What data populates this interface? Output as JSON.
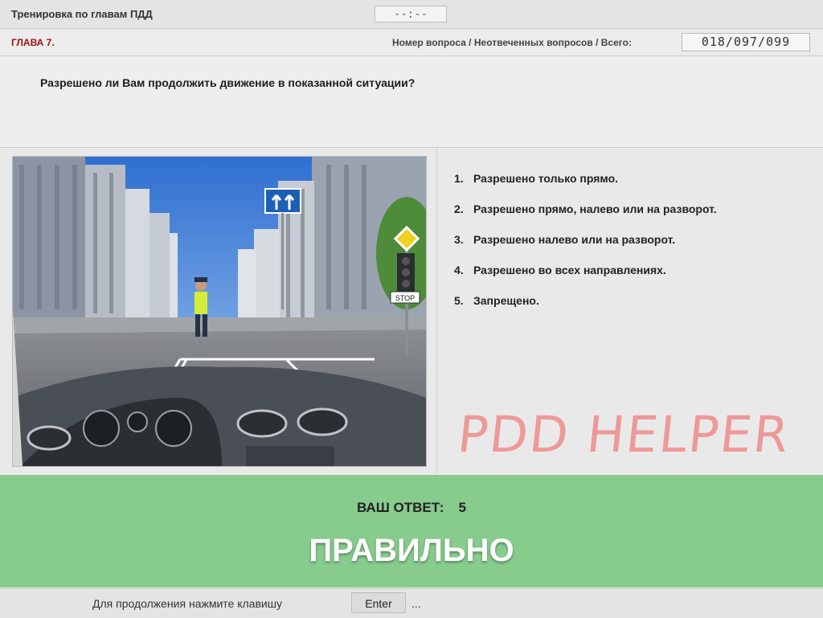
{
  "header": {
    "title": "Тренировка по главам ПДД",
    "timer": "--:--"
  },
  "info": {
    "chapter": "ГЛАВА 7.",
    "counter_label": "Номер вопроса / Неотвеченных вопросов / Всего:",
    "counter_value": "018/097/099"
  },
  "question": "Разрешено ли Вам продолжить движение в показанной ситуации?",
  "scene": {
    "sign_text": "STOP"
  },
  "answers": [
    {
      "num": "1.",
      "text": "Разрешено только прямо."
    },
    {
      "num": "2.",
      "text": "Разрешено прямо, налево или на разворот."
    },
    {
      "num": "3.",
      "text": "Разрешено налево или на разворот."
    },
    {
      "num": "4.",
      "text": "Разрешено во всех направлениях."
    },
    {
      "num": "5.",
      "text": "Запрещено."
    }
  ],
  "watermark": "PDD HELPER",
  "result": {
    "label": "ВАШ  ОТВЕТ:",
    "value": "5",
    "verdict": "ПРАВИЛЬНО",
    "color": "#87cc8d"
  },
  "footer": {
    "text": "Для продолжения нажмите клавишу",
    "key": "Enter",
    "ellipsis": "..."
  }
}
